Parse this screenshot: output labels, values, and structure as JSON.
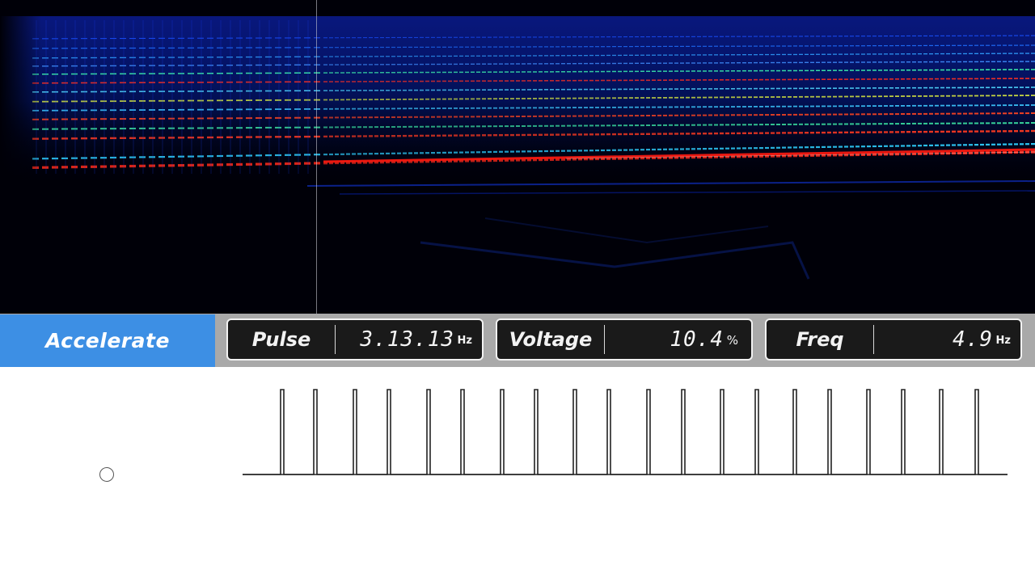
{
  "mode": {
    "label": "Accelerate"
  },
  "meters": [
    {
      "id": "pulse",
      "label": "Pulse",
      "value": "3.13.13",
      "unit": "Hz"
    },
    {
      "id": "voltage",
      "label": "Voltage",
      "value": "10.4",
      "unit": "%"
    },
    {
      "id": "freq",
      "label": "Freq",
      "value": "4.9",
      "unit": "Hz"
    }
  ],
  "colors": {
    "mode_tab": "#3d8fe4",
    "meter_bg": "#1a1a1a",
    "status_bar": "#a9a9a9",
    "spectrogram_bg": "#000008"
  },
  "icons": {
    "record": "circle-outline-icon"
  }
}
